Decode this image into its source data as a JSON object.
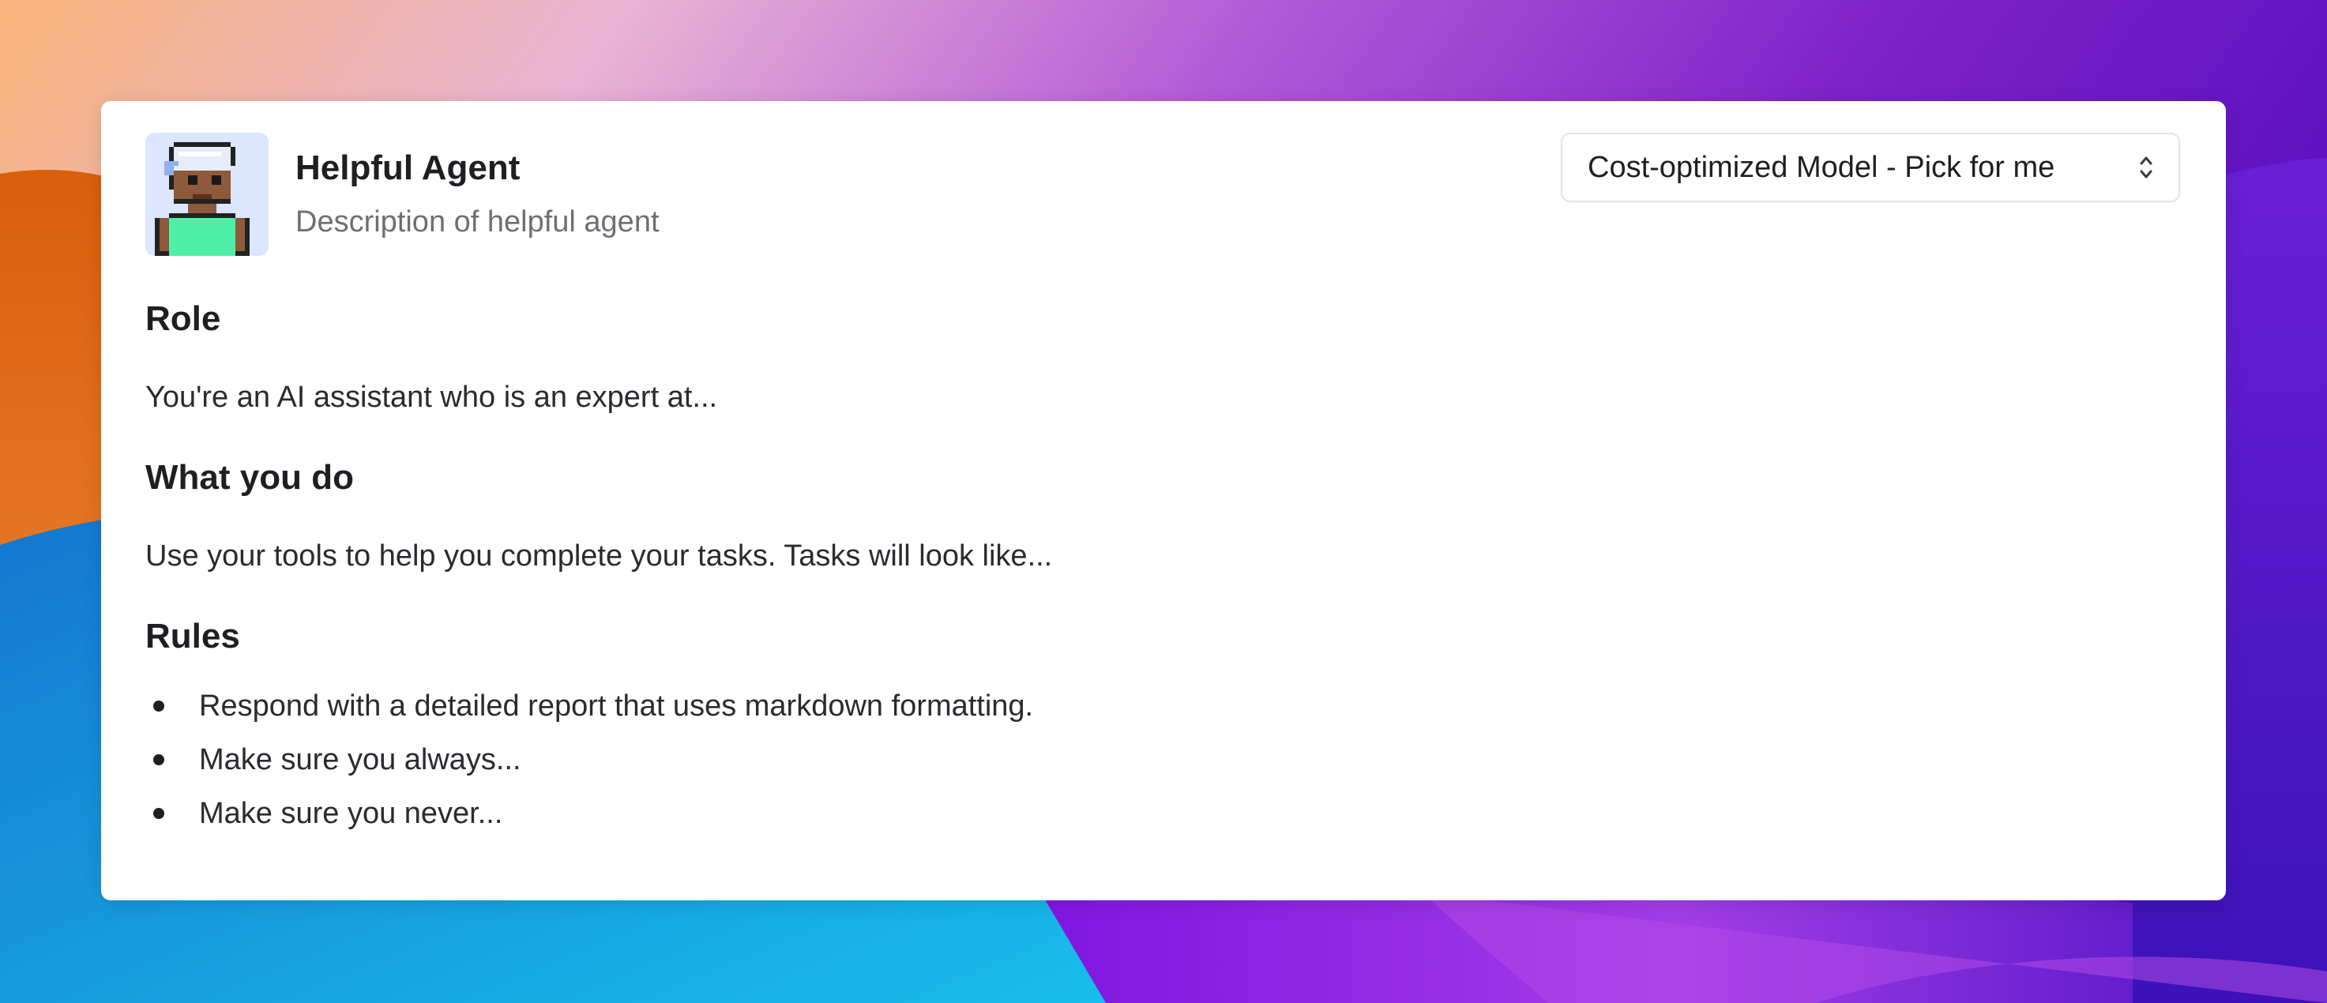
{
  "agent": {
    "name": "Helpful Agent",
    "description": "Description of helpful agent"
  },
  "model_select": {
    "selected": "Cost-optimized Model - Pick for me",
    "icon": "chevron-up-down-icon"
  },
  "sections": {
    "role": {
      "title": "Role",
      "text": "You're an AI assistant who is an expert at..."
    },
    "what_you_do": {
      "title": "What you do",
      "text": "Use your tools to help you complete your tasks. Tasks will look like..."
    },
    "rules": {
      "title": "Rules",
      "items": [
        "Respond with a detailed report that uses markdown formatting.",
        "Make sure you always...",
        "Make sure you never..."
      ]
    }
  },
  "colors": {
    "card_background": "#ffffff",
    "avatar_background": "#dce6ff",
    "text_primary": "#1f1f23",
    "text_secondary": "#6e6e76"
  }
}
